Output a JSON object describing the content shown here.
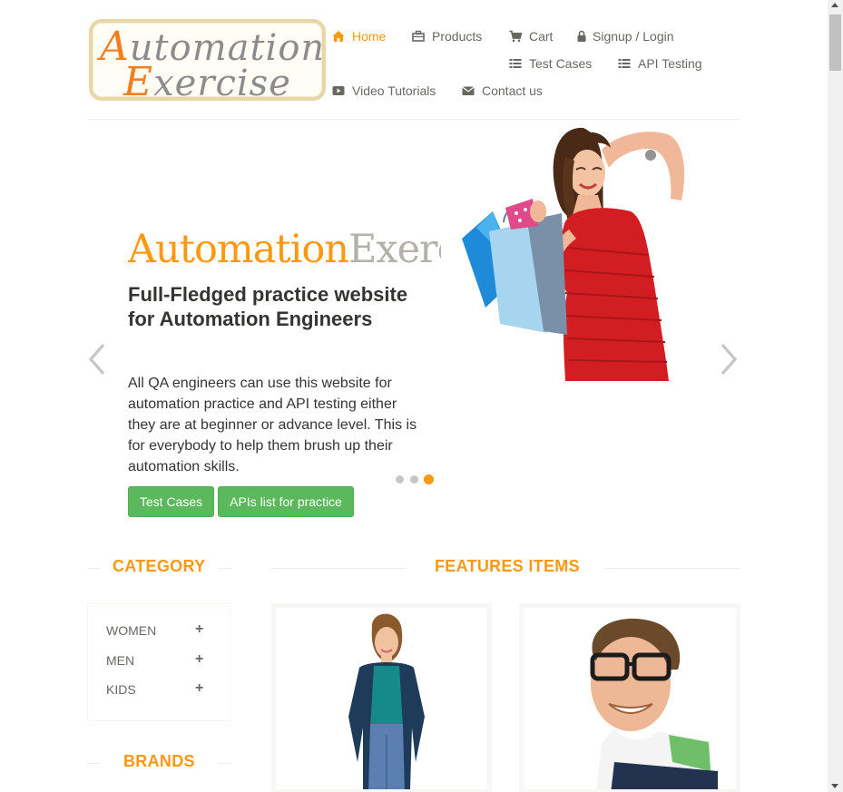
{
  "logo": {
    "line1_cap": "A",
    "line1_rest": "utomation",
    "line2_cap": "E",
    "line2_rest": "xercise"
  },
  "nav": {
    "home": "Home",
    "products": "Products",
    "cart": "Cart",
    "signup_login": "Signup / Login",
    "test_cases": "Test Cases",
    "api_testing": "API Testing",
    "video_tutorials": "Video Tutorials",
    "contact_us": "Contact us"
  },
  "slider": {
    "title_a": "Automation",
    "title_b": "Exercise",
    "heading": "Full-Fledged practice website for Automation Engineers",
    "text": "All QA engineers can use this website for automation practice and API testing either they are at beginner or advance level. This is for everybody to help them brush up their automation skills.",
    "btn_test_cases": "Test Cases",
    "btn_apis": "APIs list for practice",
    "active_slide": 3,
    "slide_count": 3
  },
  "sidebar": {
    "category_title": "CATEGORY",
    "categories": [
      "WOMEN",
      "MEN",
      "KIDS"
    ],
    "brands_title": "BRANDS"
  },
  "features": {
    "title": "FEATURES ITEMS"
  },
  "colors": {
    "accent": "#FE980F",
    "button_green": "#5CB85C",
    "text_dark": "#363432",
    "text_muted": "#696763"
  },
  "icons": [
    "home-icon",
    "products-icon",
    "cart-icon",
    "lock-icon",
    "list-icon",
    "video-icon",
    "envelope-icon",
    "chevron-left-icon",
    "chevron-right-icon",
    "plus-icon"
  ]
}
